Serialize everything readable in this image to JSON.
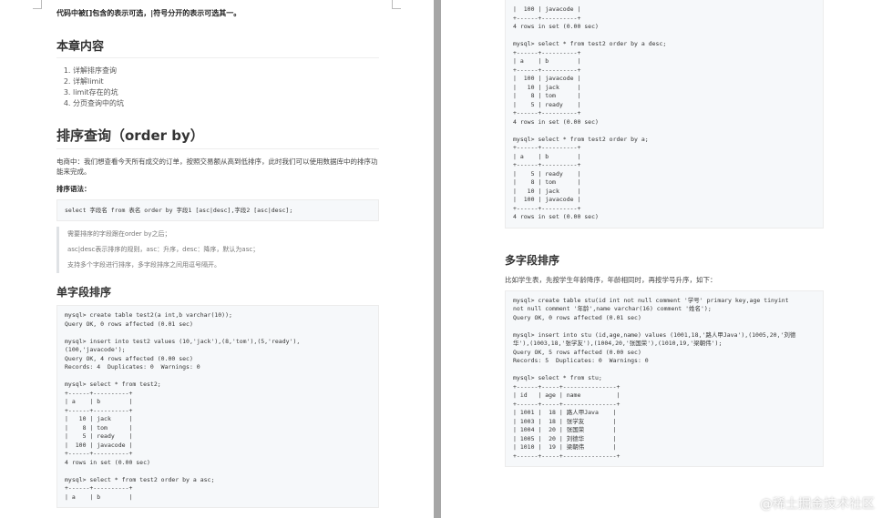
{
  "left_page": {
    "intro": "代码中被[]包含的表示可选，|符号分开的表示可选其一。",
    "chapter_title": "本章内容",
    "toc": [
      "详解排序查询",
      "详解limit",
      "limit存在的坑",
      "分页查询中的坑"
    ],
    "sort_title": "排序查询（order by）",
    "sort_desc": "电商中：我们想查看今天所有成交的订单，按照交易额从高到低排序，此时我们可以使用数据库中的排序功能来完成。",
    "syntax_label": "排序语法：",
    "syntax_code": "select 字段名 from 表名 order by 字段1 [asc|desc],字段2 [asc|desc];",
    "notes": [
      "需要排序的字段跟在order by之后；",
      "asc|desc表示排序的规则，asc：升序，desc：降序，默认为asc；",
      "支持多个字段进行排序，多字段排序之间用逗号隔开。"
    ],
    "single_title": "单字段排序",
    "single_code": "mysql> create table test2(a int,b varchar(10));\nQuery OK, 0 rows affected (0.01 sec)\n\nmysql> insert into test2 values (10,'jack'),(8,'tom'),(5,'ready'),\n(100,'javacode');\nQuery OK, 4 rows affected (0.00 sec)\nRecords: 4  Duplicates: 0  Warnings: 0\n\nmysql> select * from test2;\n+------+----------+\n| a    | b        |\n+------+----------+\n|   10 | jack     |\n|    8 | tom      |\n|    5 | ready    |\n|  100 | javacode |\n+------+----------+\n4 rows in set (0.00 sec)\n\nmysql> select * from test2 order by a asc;\n+------+----------+\n| a    | b        |"
  },
  "right_page": {
    "top_code": "|  100 | javacode |\n+------+----------+\n4 rows in set (0.00 sec)\n\nmysql> select * from test2 order by a desc;\n+------+----------+\n| a    | b        |\n+------+----------+\n|  100 | javacode |\n|   10 | jack     |\n|    8 | tom      |\n|    5 | ready    |\n+------+----------+\n4 rows in set (0.00 sec)\n\nmysql> select * from test2 order by a;\n+------+----------+\n| a    | b        |\n+------+----------+\n|    5 | ready    |\n|    8 | tom      |\n|   10 | jack     |\n|  100 | javacode |\n+------+----------+\n4 rows in set (0.00 sec)",
    "multi_title": "多字段排序",
    "multi_desc": "比如学生表，先按学生年龄降序，年龄相同时，再按学号升序，如下：",
    "multi_code": "mysql> create table stu(id int not null comment '学号' primary key,age tinyint\nnot null comment '年龄',name varchar(16) comment '姓名');\nQuery OK, 0 rows affected (0.01 sec)\n\nmysql> insert into stu (id,age,name) values (1001,18,'路人甲Java'),(1005,20,'刘德\n华'),(1003,18,'张学友'),(1004,20,'张国荣'),(1010,19,'梁朝伟');\nQuery OK, 5 rows affected (0.00 sec)\nRecords: 5  Duplicates: 0  Warnings: 0\n\nmysql> select * from stu;\n+------+-----+---------------+\n| id   | age | name          |\n+------+-----+---------------+\n| 1001 |  18 | 路人甲Java    |\n| 1003 |  18 | 张学友        |\n| 1004 |  20 | 张国荣        |\n| 1005 |  20 | 刘德华        |\n| 1010 |  19 | 梁朝伟        |\n+------+-----+---------------+"
  },
  "watermark": "@稀土掘金技术社区"
}
